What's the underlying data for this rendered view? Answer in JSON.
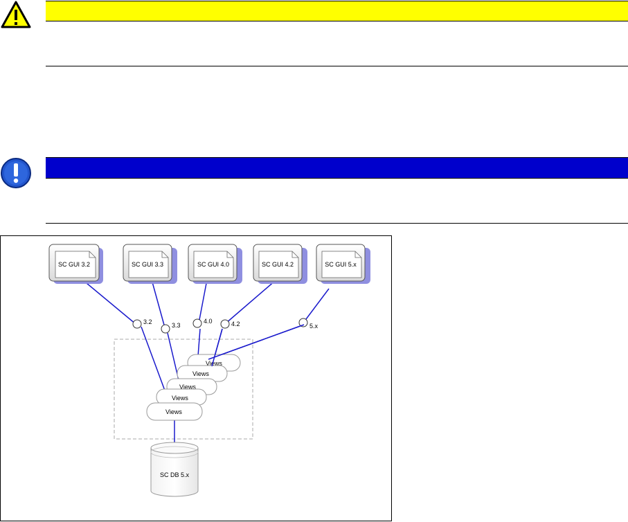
{
  "icons": {
    "warning": "warning-triangle-icon",
    "important": "exclamation-circle-icon"
  },
  "colors": {
    "warning_bar": "#ffff00",
    "note_bar": "#0000cc",
    "link_line": "#1a1acc",
    "shadow": "#8f8fe0"
  },
  "diagram": {
    "gui_boxes": [
      {
        "label": "SC GUI 3.2"
      },
      {
        "label": "SC GUI 3.3"
      },
      {
        "label": "SC GUI 4.0"
      },
      {
        "label": "SC GUI 4.2"
      },
      {
        "label": "SC GUI 5.x"
      }
    ],
    "interfaces": [
      {
        "label": "3.2"
      },
      {
        "label": "3.3"
      },
      {
        "label": "4.0"
      },
      {
        "label": "4.2"
      },
      {
        "label": "5.x"
      }
    ],
    "views": [
      {
        "label": "Views"
      },
      {
        "label": "Views"
      },
      {
        "label": "Views"
      },
      {
        "label": "Views"
      },
      {
        "label": "Views"
      }
    ],
    "database": {
      "label": "SC DB 5.x"
    }
  }
}
